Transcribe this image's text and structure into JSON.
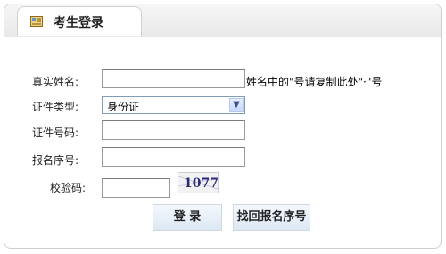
{
  "panel": {
    "title": "考生登录",
    "icon": "login-icon"
  },
  "form": {
    "name_label": "真实姓名:",
    "name_value": "",
    "name_hint": "姓名中的\"号请复制此处\"·\"号",
    "id_type_label": "证件类型:",
    "id_type_selected": "身份证",
    "id_number_label": "证件号码:",
    "id_number_value": "",
    "reg_number_label": "报名序号:",
    "reg_number_value": "",
    "captcha_label": "校验码:",
    "captcha_value": "",
    "captcha_text": "1077"
  },
  "buttons": {
    "login": "登 录",
    "recover": "找回报名序号"
  }
}
